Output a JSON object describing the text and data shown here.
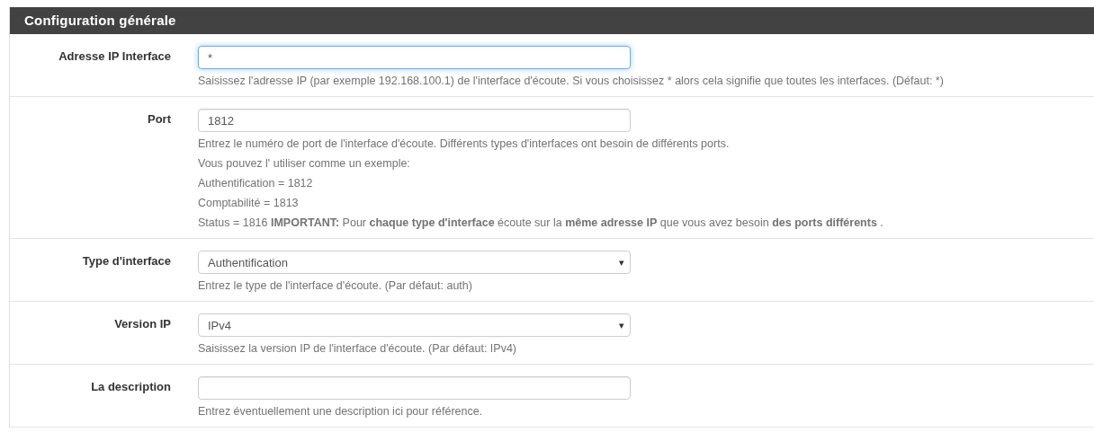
{
  "panel": {
    "title": "Configuration générale"
  },
  "rows": [
    {
      "label": "Adresse IP Interface",
      "control": {
        "kind": "text",
        "value": "*",
        "focused": true
      },
      "help": [
        "Saisissez l'adresse IP (par exemple 192.168.100.1) de l'interface d'écoute. Si vous choisissez * alors cela signifie que toutes les interfaces. (Défaut: *)"
      ]
    },
    {
      "label": "Port",
      "control": {
        "kind": "text",
        "value": "1812",
        "focused": false
      },
      "help": [
        "Entrez le numéro de port de l'interface d'écoute. Différents types d'interfaces ont besoin de différents ports.",
        "Vous pouvez l' utiliser comme un exemple:",
        "Authentification = 1812",
        "Comptabilité = 1813",
        "Status = 1816 **IMPORTANT:** Pour **chaque type d'interface** écoute sur la **même adresse IP** que vous avez besoin **des ports différents** ."
      ]
    },
    {
      "label": "Type d'interface",
      "control": {
        "kind": "select",
        "value": "Authentification",
        "caret": "▾"
      },
      "help": [
        "Entrez le type de l'interface d'écoute. (Par défaut: auth)"
      ]
    },
    {
      "label": "Version IP",
      "control": {
        "kind": "select",
        "value": "IPv4",
        "caret": "▾"
      },
      "help": [
        "Saisissez la version IP de l'interface d'écoute. (Par défaut: IPv4)"
      ]
    },
    {
      "label": "La description",
      "control": {
        "kind": "text",
        "focused": false
      },
      "help": [
        "Entrez éventuellement une description ici pour référence."
      ]
    }
  ]
}
